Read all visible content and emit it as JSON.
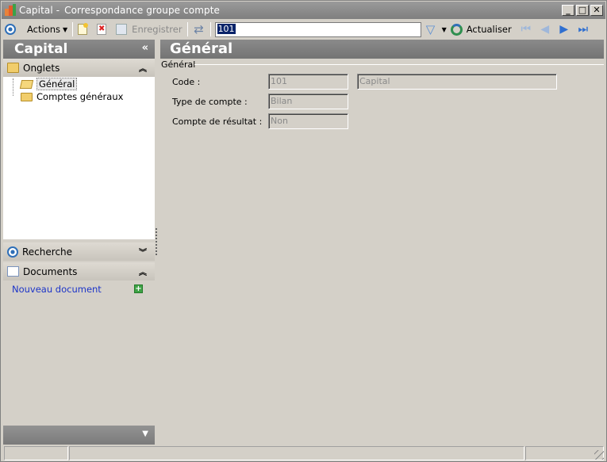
{
  "window": {
    "record_name": "Capital -",
    "title": "Correspondance groupe compte"
  },
  "window_controls": {
    "minimize": "_",
    "maximize": "□",
    "close": "✕"
  },
  "toolbar": {
    "actions_label": "Actions",
    "save_label": "Enregistrer",
    "search_value": "101",
    "refresh_label": "Actualiser"
  },
  "sidebar": {
    "header": "Capital",
    "collapse_glyph": "«",
    "tabs_section": "Onglets",
    "tree_items": [
      {
        "label": "Général",
        "selected": true
      },
      {
        "label": "Comptes généraux",
        "selected": false
      }
    ],
    "search_section": "Recherche",
    "documents_section": "Documents",
    "new_document_link": "Nouveau document"
  },
  "main": {
    "header": "Général",
    "group_title": "Général",
    "fields": [
      {
        "label": "Code :",
        "value": "101",
        "secondary_value": "Capital"
      },
      {
        "label": "Type de compte :",
        "value": "Bilan"
      },
      {
        "label": "Compte de résultat :",
        "value": "Non"
      }
    ]
  },
  "colors": {
    "header_gray": "#7f7f7f",
    "link_blue": "#1d35c8",
    "nav_blue": "#2f6fd0"
  }
}
